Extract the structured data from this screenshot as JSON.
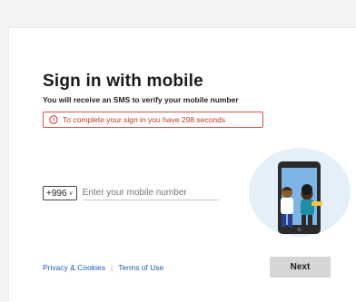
{
  "signin": {
    "title": "Sign in with mobile",
    "subtitle": "You will receive an SMS to verify your mobile number",
    "alert": {
      "icon": "alert-circle-icon",
      "text": "To complete your sign in you have 298 seconds",
      "color": "#d9534f"
    },
    "phone": {
      "country_code": "+996",
      "placeholder": "Enter your mobile number",
      "value": ""
    },
    "footer": {
      "privacy_label": "Privacy & Cookies",
      "separator": "|",
      "terms_label": "Terms of Use"
    },
    "next_label": "Next",
    "illustration": "phone-with-people-illustration"
  }
}
